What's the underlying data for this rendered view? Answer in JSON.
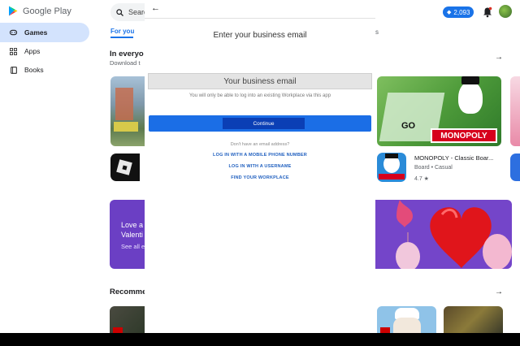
{
  "sidebar": {
    "brand": "Google Play",
    "items": [
      {
        "label": "Games",
        "icon": "gamepad-icon",
        "active": true
      },
      {
        "label": "Apps",
        "icon": "apps-grid-icon",
        "active": false
      },
      {
        "label": "Books",
        "icon": "book-icon",
        "active": false
      }
    ]
  },
  "header": {
    "search_text": "Searc",
    "points": "2,093",
    "tabs": {
      "for_you": "For you",
      "fragment_right": "s"
    }
  },
  "sections": {
    "everyone": {
      "title": "In everyo",
      "subtitle": "Download t"
    },
    "banner": {
      "line1": "Love a",
      "line2": "Valenti",
      "link": "See all e"
    },
    "recommended": {
      "title": "Recomme"
    }
  },
  "apps": {
    "monopoly": {
      "name": "MONOPOLY - Classic Boar...",
      "meta": "Board • Casual",
      "rating": "4.7 ★",
      "tile_text": "MONOPOLY",
      "go_text": "GO"
    }
  },
  "modal": {
    "title": "Enter your business email",
    "email_placeholder": "Your business email",
    "note": "You will only be able to log into an existing Workplace via this app",
    "continue_label": "Continue",
    "no_email": "Don't have an email address?",
    "links": [
      "LOG IN WITH A MOBILE PHONE NUMBER",
      "LOG IN WITH A USERNAME",
      "FIND YOUR WORKPLACE"
    ]
  },
  "colors": {
    "accent": "#1a73e8",
    "active_nav": "#d3e3fd",
    "banner_purple": "#6b3fc4",
    "continue_blue": "#1b6ee6"
  }
}
